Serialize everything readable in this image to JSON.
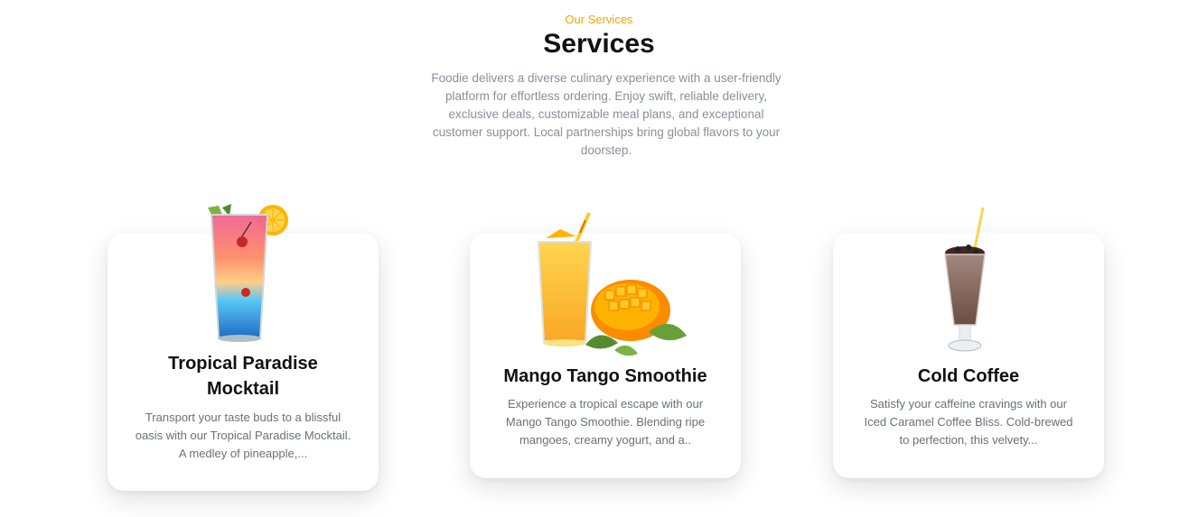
{
  "header": {
    "eyebrow": "Our Services",
    "title": "Services",
    "intro": "Foodie delivers a diverse culinary experience with a user-friendly platform for effortless ordering. Enjoy swift, reliable delivery, exclusive deals, customizable meal plans, and exceptional customer support. Local partnerships bring global flavors to your doorstep."
  },
  "cards": [
    {
      "title_line1": "Tropical Paradise",
      "title_line2": "Mocktail",
      "desc": "Transport your taste buds to a blissful oasis with our Tropical Paradise Mocktail. A medley of pineapple,...",
      "image": "tropical-mocktail-image"
    },
    {
      "title": "Mango Tango Smoothie",
      "desc": "Experience a tropical escape with our Mango Tango Smoothie. Blending ripe mangoes, creamy yogurt, and a..",
      "image": "mango-smoothie-image"
    },
    {
      "title": "Cold Coffee",
      "desc": "Satisfy your caffeine cravings with our Iced Caramel Coffee Bliss. Cold-brewed to perfection, this velvety...",
      "image": "cold-coffee-image"
    }
  ],
  "colors": {
    "accent": "#f5a300",
    "text": "#111111",
    "muted": "#8a8f99"
  }
}
